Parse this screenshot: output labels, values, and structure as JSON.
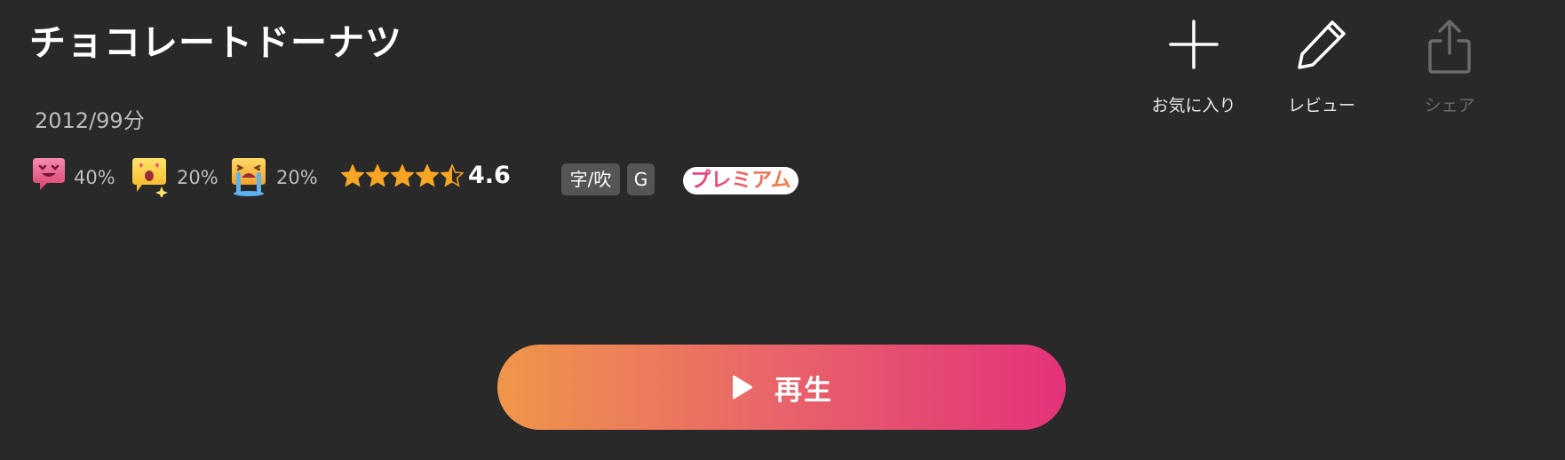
{
  "title": "チョコレートドーナツ",
  "meta": "2012/99分",
  "reactions": [
    {
      "icon": "heart-eyes-emoji-icon",
      "percent": "40%"
    },
    {
      "icon": "starstruck-emoji-icon",
      "percent": "20%"
    },
    {
      "icon": "crying-emoji-icon",
      "percent": "20%"
    }
  ],
  "rating": {
    "stars": 4.5,
    "max": 5,
    "value": "4.6"
  },
  "badges": {
    "subtitle_dub": "字/吹",
    "age_rating": "G"
  },
  "premium_label": "プレミアム",
  "actions": {
    "favorite": {
      "label": "お気に入り",
      "icon": "plus-icon"
    },
    "review": {
      "label": "レビュー",
      "icon": "pencil-icon"
    },
    "share": {
      "label": "シェア",
      "icon": "share-icon",
      "disabled": true
    }
  },
  "play": {
    "label": "再生",
    "icon": "play-icon"
  },
  "colors": {
    "background": "#292929",
    "play_gradient_start": "#f0964a",
    "play_gradient_end": "#e3327a",
    "star": "#f6a623",
    "badge_bg": "#555555"
  }
}
